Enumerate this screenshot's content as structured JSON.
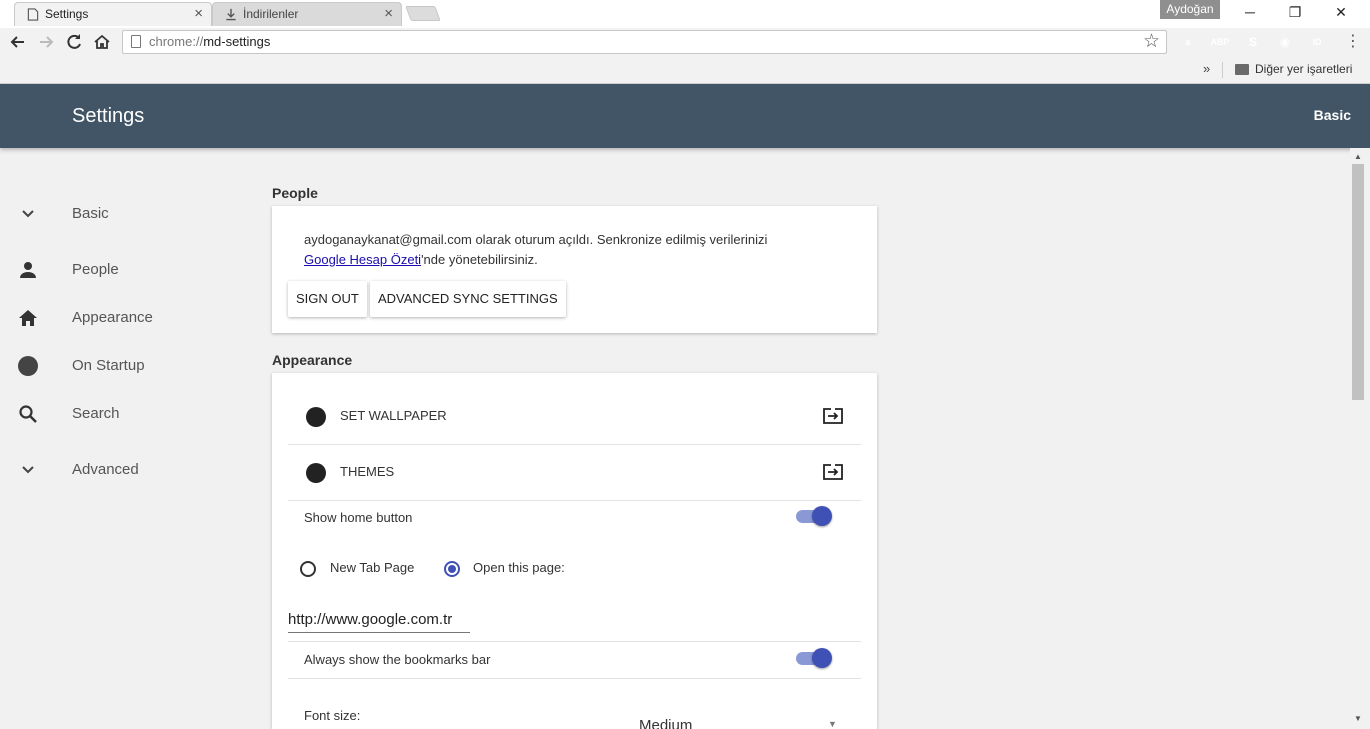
{
  "browser": {
    "tabs": [
      {
        "title": "Settings"
      },
      {
        "title": "İndirilenler"
      }
    ],
    "profile_name": "Aydoğan",
    "url_scheme": "chrome://",
    "url_path": "md-settings",
    "bookmarks_other_label": "Diğer yer işaretleri",
    "extensions": [
      {
        "name": "amazon-assistant",
        "text": "a",
        "color": "#3b5fa9"
      },
      {
        "name": "adblock-plus",
        "text": "ABP",
        "color": "#d32f2f"
      },
      {
        "name": "skype",
        "text": "S",
        "color": "#1aa0e6"
      },
      {
        "name": "screenshot",
        "text": "◉",
        "color": "#7fa9c9"
      },
      {
        "name": "id-ext",
        "text": "ID",
        "color": "#3a9f3a"
      }
    ]
  },
  "header": {
    "title": "Settings",
    "right_label": "Basic"
  },
  "sidebar": {
    "items": [
      {
        "label": "Basic",
        "icon": "chevron-down-icon"
      },
      {
        "label": "People",
        "icon": "person-icon"
      },
      {
        "label": "Appearance",
        "icon": "home-icon"
      },
      {
        "label": "On Startup",
        "icon": "circle-icon"
      },
      {
        "label": "Search",
        "icon": "search-icon"
      },
      {
        "label": "Advanced",
        "icon": "chevron-down-icon"
      }
    ]
  },
  "people": {
    "section_title": "People",
    "signed_in_text": "aydoganaykanat@gmail.com olarak oturum açıldı. Senkronize edilmiş verilerinizi",
    "link_text": "Google Hesap Özeti",
    "after_link_text": "'nde yönetebilirsiniz.",
    "sign_out_label": "SIGN OUT",
    "advanced_sync_label": "ADVANCED SYNC SETTINGS"
  },
  "appearance": {
    "section_title": "Appearance",
    "set_wallpaper_label": "SET WALLPAPER",
    "themes_label": "THEMES",
    "show_home_button_label": "Show home button",
    "show_home_button_on": true,
    "new_tab_page_label": "New Tab Page",
    "open_this_page_label": "Open this page:",
    "home_url_value": "http://www.google.com.tr",
    "bookmarks_bar_label": "Always show the bookmarks bar",
    "bookmarks_bar_on": true,
    "font_size_label": "Font size:",
    "font_size_value": "Medium"
  }
}
